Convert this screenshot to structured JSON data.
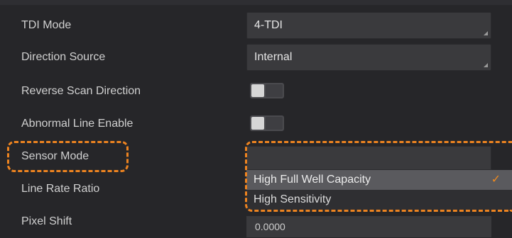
{
  "rows": [
    {
      "label": "TDI Mode",
      "value": "4-TDI"
    },
    {
      "label": "Direction Source",
      "value": "Internal"
    },
    {
      "label": "Reverse Scan Direction"
    },
    {
      "label": "Abnormal Line Enable"
    },
    {
      "label": "Sensor Mode"
    },
    {
      "label": "Line Rate Ratio"
    },
    {
      "label": "Pixel Shift",
      "value": "0.0000"
    }
  ],
  "sensor_mode_dropdown": {
    "options": [
      "High Full Well Capacity",
      "High Sensitivity"
    ],
    "selected": "High Full Well Capacity"
  },
  "toggles": {
    "reverse_scan_direction": "off",
    "abnormal_line_enable": "off"
  },
  "colors": {
    "highlight": "#ee8420",
    "checkmark": "#f08a1e",
    "background": "#26262a"
  },
  "icons": {
    "check": "✓"
  }
}
